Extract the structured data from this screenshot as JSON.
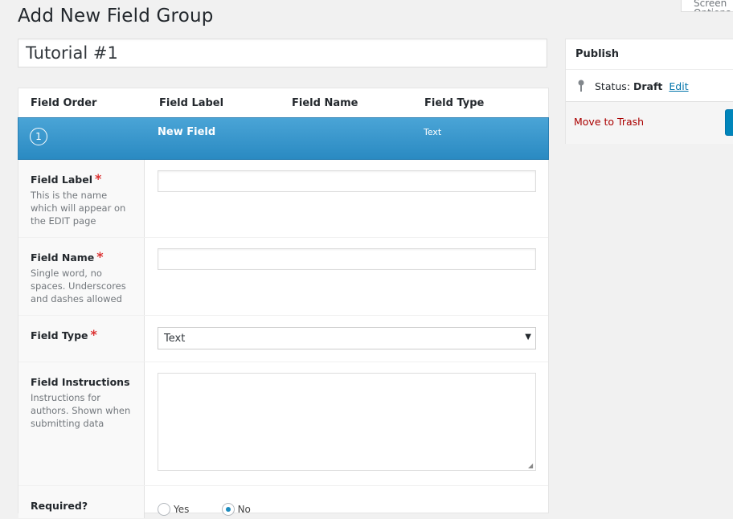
{
  "screen_options": "Screen Options",
  "page_title": "Add New Field Group",
  "title_input_value": "Tutorial #1",
  "fields_table": {
    "headers": [
      "Field Order",
      "Field Label",
      "Field Name",
      "Field Type"
    ],
    "row": {
      "order": "1",
      "label": "New Field",
      "type": "Text"
    }
  },
  "settings": {
    "label": {
      "title": "Field Label",
      "required": "*",
      "description": "This is the name which will appear on the EDIT page",
      "value": ""
    },
    "name": {
      "title": "Field Name",
      "required": "*",
      "description": "Single word, no spaces. Underscores and dashes allowed",
      "value": ""
    },
    "type": {
      "title": "Field Type",
      "required": "*",
      "selected": "Text"
    },
    "instructions": {
      "title": "Field Instructions",
      "description": "Instructions for authors. Shown when submitting data",
      "value": ""
    },
    "required": {
      "title": "Required?",
      "options": [
        "Yes",
        "No"
      ],
      "selected": "No"
    }
  },
  "publish": {
    "title": "Publish",
    "status_label": "Status:",
    "status_value": "Draft",
    "edit_link": "Edit",
    "trash_link": "Move to Trash"
  },
  "icons": {
    "status": "pin-icon",
    "select": "chevron-down-icon",
    "resize": "resize-grip-icon"
  },
  "colors": {
    "accent": "#2a8ac2",
    "required": "#dc3232",
    "trash": "#aa0000",
    "link": "#0073aa"
  }
}
